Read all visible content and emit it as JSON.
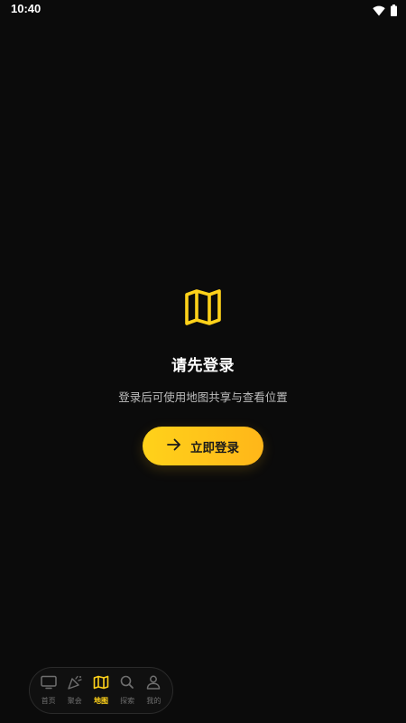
{
  "status_bar": {
    "time": "10:40",
    "icons": [
      "wifi-icon",
      "battery-icon"
    ]
  },
  "empty_state": {
    "icon": "map-icon",
    "title": "请先登录",
    "subtitle": "登录后可使用地图共享与查看位置",
    "button": {
      "label": "立即登录",
      "icon": "arrow-right-icon"
    }
  },
  "bottom_nav": {
    "items": [
      {
        "label": "首页",
        "icon": "tv-icon",
        "active": false
      },
      {
        "label": "聚会",
        "icon": "party-popper-icon",
        "active": false
      },
      {
        "label": "地图",
        "icon": "map-icon",
        "active": true
      },
      {
        "label": "探索",
        "icon": "search-icon",
        "active": false
      },
      {
        "label": "我的",
        "icon": "user-icon",
        "active": false
      }
    ]
  },
  "colors": {
    "background": "#0b0b0b",
    "accent": "#ffd21a",
    "accent_end": "#ffb619",
    "inactive": "#6f6f6f"
  }
}
